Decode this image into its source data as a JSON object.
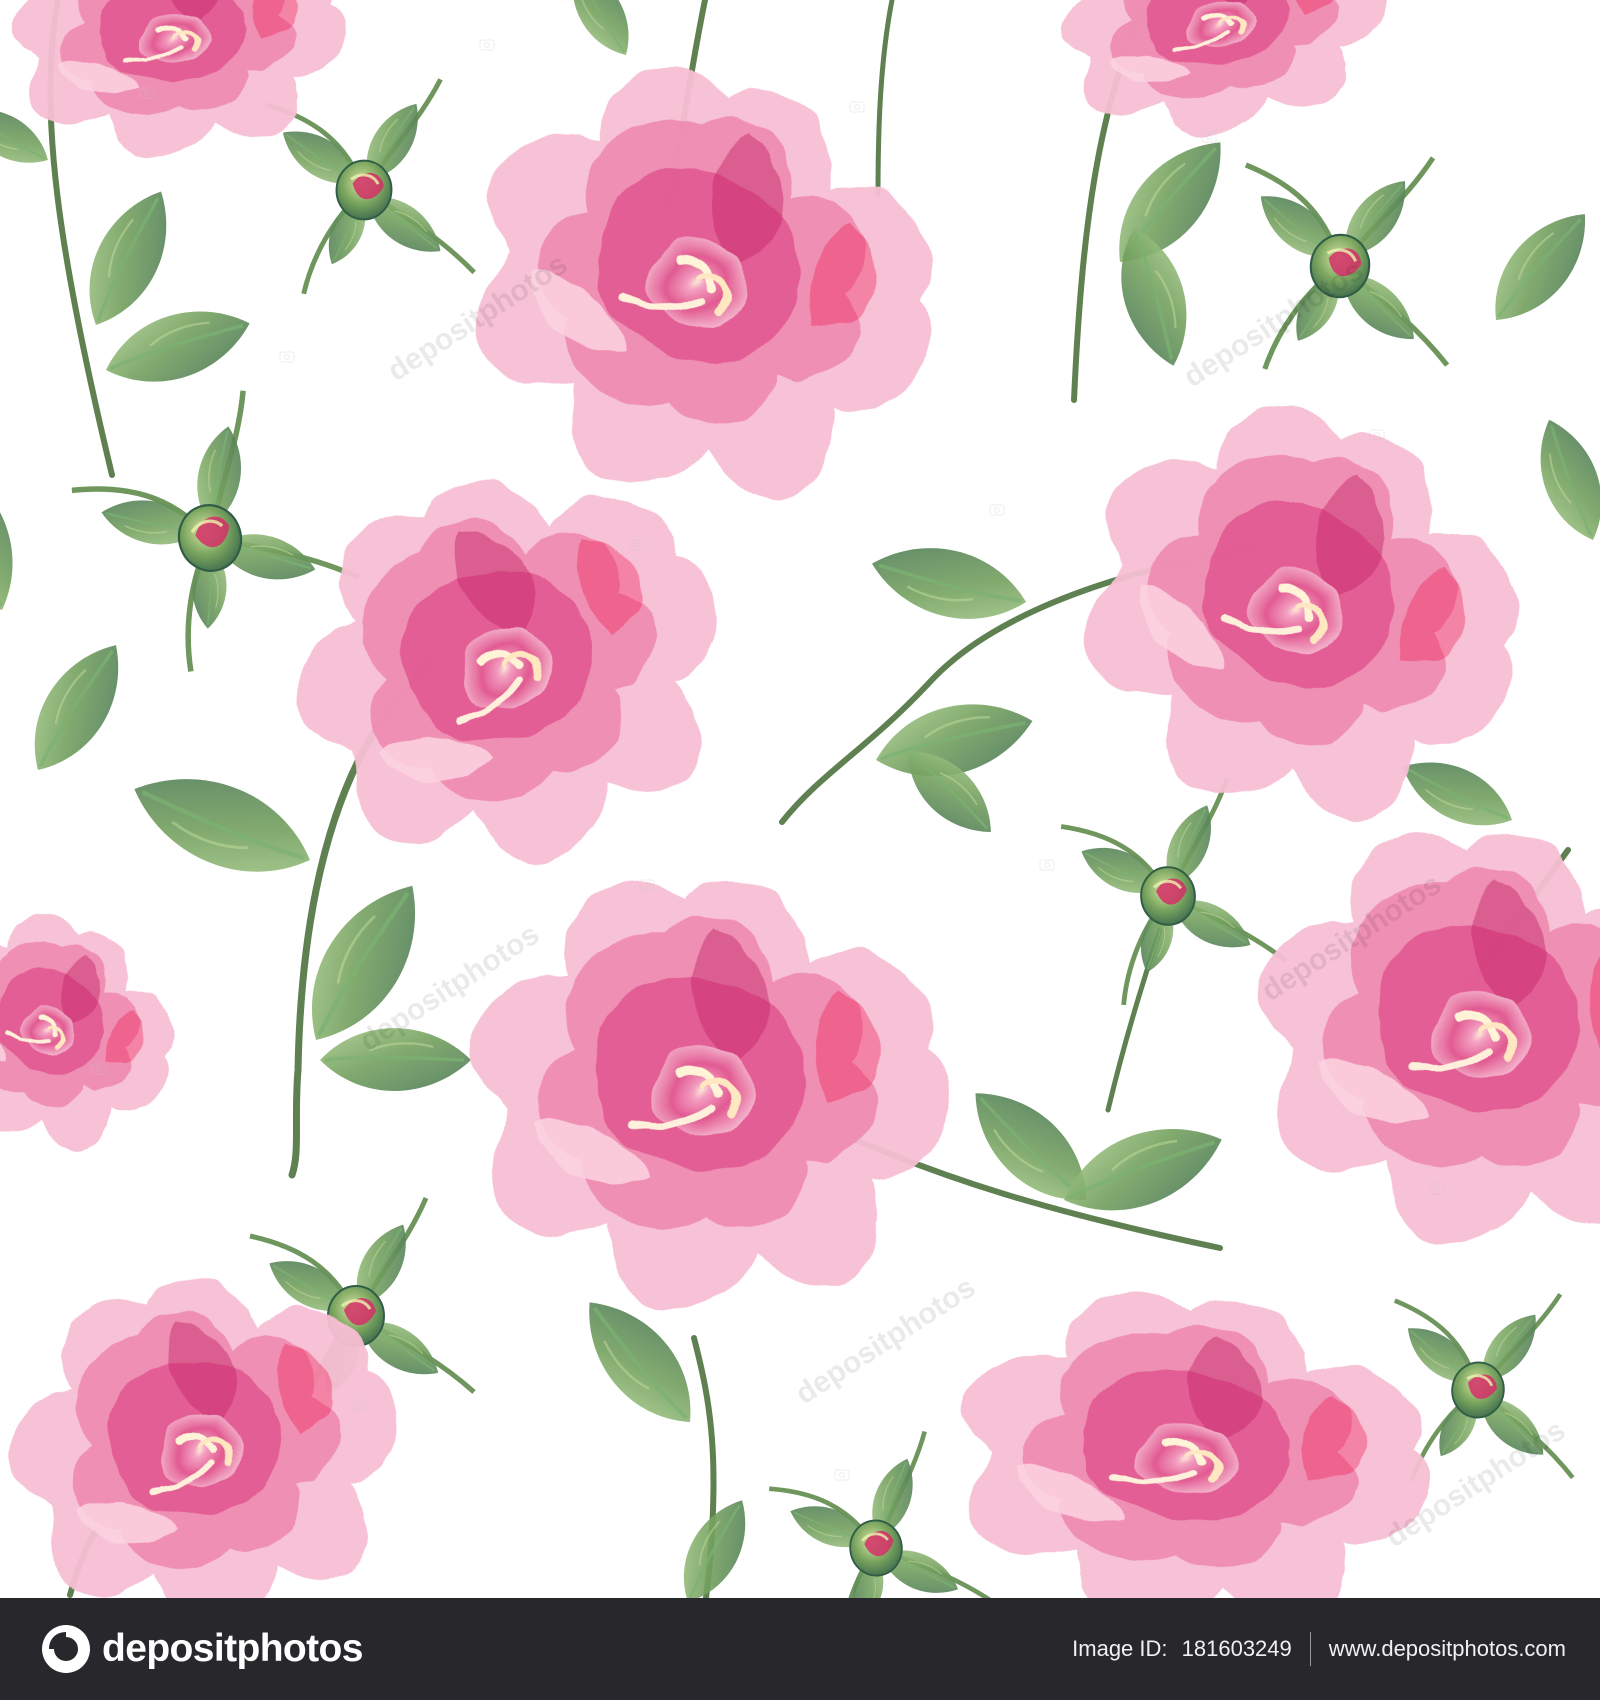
{
  "image": {
    "subject": "Seamless watercolor pattern with pink peonies, buds and green leaves on white background",
    "colors": {
      "background": "#ffffff",
      "petal_light": "#f7bfd4",
      "petal_mid": "#ef86ad",
      "petal_dark": "#d72f75",
      "petal_accent": "#ef1f56",
      "leaf_light": "#9ac27d",
      "leaf_mid": "#6c9958",
      "leaf_dark": "#3f6d4e",
      "footer": "#27272c"
    }
  },
  "watermark": {
    "repeated_text": "depositphotos"
  },
  "footer": {
    "brand": "depositphotos",
    "image_id_label": "Image ID:",
    "image_id": "181603249",
    "website": "www.depositphotos.com"
  }
}
